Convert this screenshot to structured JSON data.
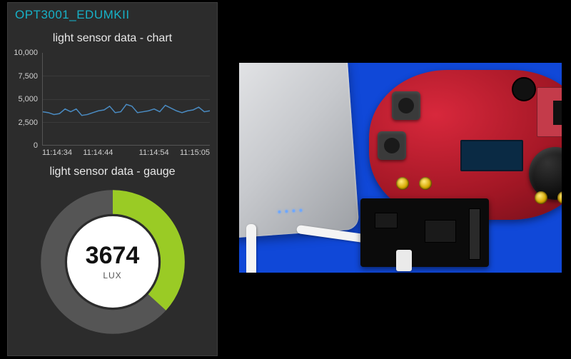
{
  "panel": {
    "title": "OPT3001_EDUMKII",
    "chart": {
      "title": "light sensor data - chart"
    },
    "gauge": {
      "title": "light sensor data - gauge",
      "value": "3674",
      "unit": "LUX",
      "max": 10000,
      "fill_color": "#9acb25",
      "track_color": "#555555"
    }
  },
  "chart_data": {
    "type": "line",
    "title": "light sensor data - chart",
    "xlabel": "",
    "ylabel": "",
    "ylim": [
      0,
      10000
    ],
    "y_ticks": [
      "10,000",
      "7,500",
      "5,000",
      "2,500",
      "0"
    ],
    "x_ticks": [
      "11:14:34",
      "11:14:44",
      "11:14:54",
      "11:15:05"
    ],
    "series": [
      {
        "name": "lux",
        "color": "#4a8bc2",
        "values": [
          3600,
          3500,
          3300,
          3400,
          3900,
          3600,
          3900,
          3200,
          3300,
          3500,
          3700,
          3800,
          4200,
          3500,
          3600,
          4400,
          4200,
          3500,
          3600,
          3700,
          3900,
          3600,
          4300,
          4000,
          3700,
          3500,
          3700,
          3800,
          4100,
          3600,
          3700
        ]
      }
    ]
  },
  "photo": {
    "description": "Hardware photo: silver USB power bank connected via white USB cable to a black breakout board attached under a red TI Educational BoosterPack MKII board with joystick, buttons, buzzer and small LCD, resting on a blue mat."
  }
}
